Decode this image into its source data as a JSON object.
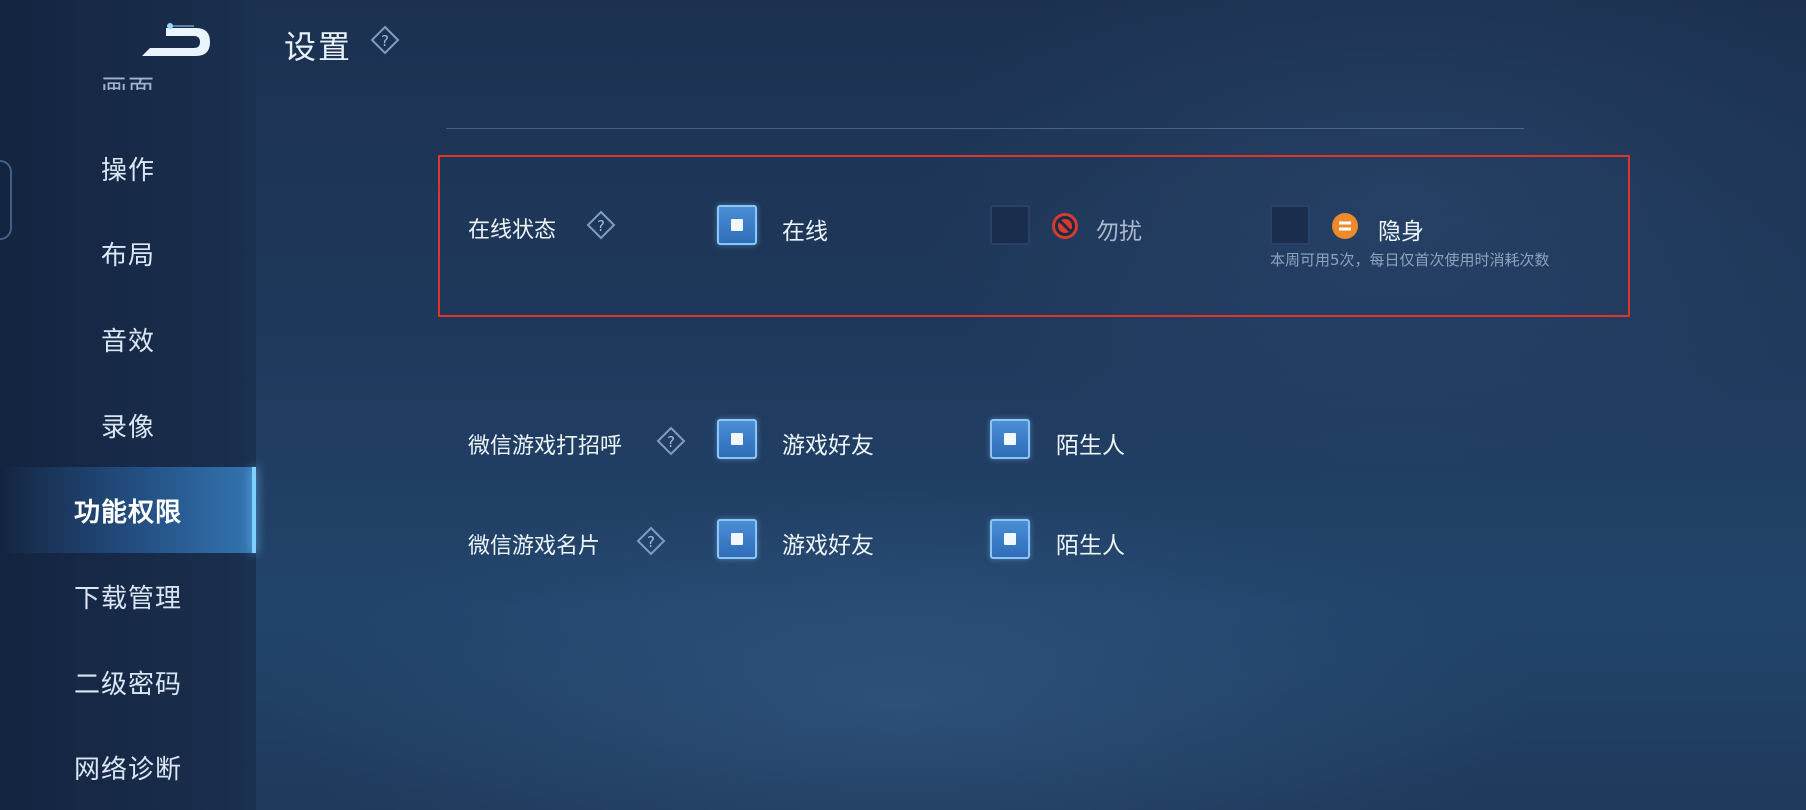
{
  "header": {
    "title": "设置"
  },
  "sidebar": {
    "items": [
      {
        "label": "画面"
      },
      {
        "label": "操作"
      },
      {
        "label": "布局"
      },
      {
        "label": "音效"
      },
      {
        "label": "录像"
      },
      {
        "label": "功能权限"
      },
      {
        "label": "下载管理"
      },
      {
        "label": "二级密码"
      },
      {
        "label": "网络诊断"
      }
    ],
    "active_index": 5
  },
  "online_status": {
    "label": "在线状态",
    "options": [
      {
        "label": "在线",
        "checked": true
      },
      {
        "label": "勿扰",
        "checked": false,
        "icon": "no-entry-icon"
      },
      {
        "label": "隐身",
        "checked": false,
        "icon": "invisible-icon"
      }
    ],
    "note": "本周可用5次，每日仅首次使用时消耗次数"
  },
  "wechat_greeting": {
    "label": "微信游戏打招呼",
    "options": [
      {
        "label": "游戏好友",
        "checked": true
      },
      {
        "label": "陌生人",
        "checked": true
      }
    ]
  },
  "wechat_card": {
    "label": "微信游戏名片",
    "options": [
      {
        "label": "游戏好友",
        "checked": true
      },
      {
        "label": "陌生人",
        "checked": true
      }
    ]
  },
  "colors": {
    "highlight_border": "#e0332c",
    "checkbox_checked": "#3a7fcc",
    "no_entry_icon": "#d83a2e",
    "invisible_icon": "#ee8a2c"
  }
}
